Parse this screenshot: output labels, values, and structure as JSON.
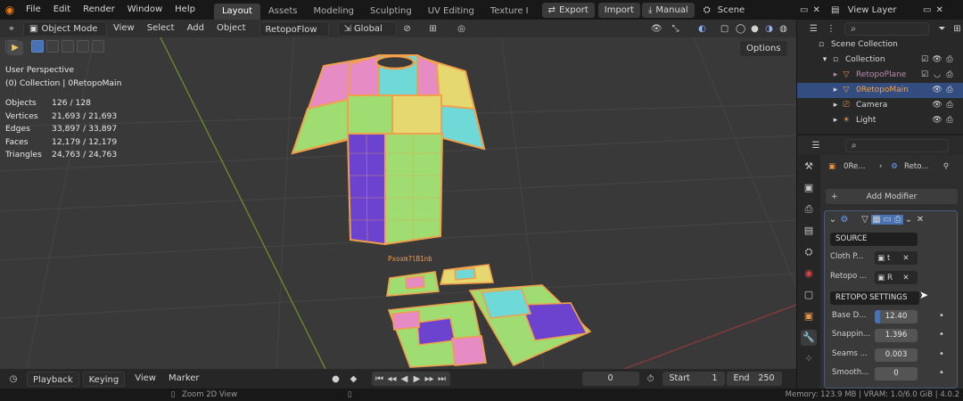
{
  "topbar": {
    "menus": [
      "File",
      "Edit",
      "Render",
      "Window",
      "Help"
    ],
    "workspaces": [
      "Layout",
      "Assets",
      "Modeling",
      "Sculpting",
      "UV Editing",
      "Texture I"
    ],
    "active_workspace": "Layout",
    "export_label": "Export",
    "import_label": "Import",
    "manual_label": "Manual",
    "scene_value": "Scene",
    "view_layer_value": "View Layer"
  },
  "viewport_header": {
    "mode": "Object Mode",
    "menus": [
      "View",
      "Select",
      "Add",
      "Object"
    ],
    "addon_menu": "RetopoFlow",
    "transform_orientation": "Global",
    "options_label": "Options"
  },
  "overlay": {
    "view_name": "User Perspective",
    "collection_line": "(0) Collection | 0RetopoMain",
    "stats": [
      {
        "label": "Objects",
        "value": "126 / 128"
      },
      {
        "label": "Vertices",
        "value": "21,693 / 21,693"
      },
      {
        "label": "Edges",
        "value": "33,897 / 33,897"
      },
      {
        "label": "Faces",
        "value": "12,179 / 12,179"
      },
      {
        "label": "Triangles",
        "value": "24,763 / 24,763"
      }
    ],
    "floor_text": "Pxoxm7lB1nb"
  },
  "timeline": {
    "playback": "Playback",
    "keying": "Keying",
    "view": "View",
    "marker": "Marker",
    "current_frame": "0",
    "start_label": "Start",
    "start_value": "1",
    "end_label": "End",
    "end_value": "250"
  },
  "statusbar": {
    "hint": "Zoom 2D View",
    "stats": "Memory: 123.9 MB | VRAM: 1.0/6.0 GiB | 4.0.2"
  },
  "outliner": {
    "search_placeholder": "",
    "items": [
      {
        "label": "Scene Collection",
        "indent": 0
      },
      {
        "label": "Collection",
        "indent": 1
      },
      {
        "label": "RetopoPlane",
        "indent": 2
      },
      {
        "label": "0RetopoMain",
        "indent": 2,
        "selected": true
      },
      {
        "label": "Camera",
        "indent": 2
      },
      {
        "label": "Light",
        "indent": 2
      }
    ]
  },
  "properties": {
    "breadcrumb_object": "0Re...",
    "breadcrumb_modifier": "Reto...",
    "add_modifier_label": "Add Modifier",
    "source_section": "SOURCE",
    "cloth_label": "Cloth P...",
    "cloth_value": "t",
    "retopo_label": "Retopo ...",
    "retopo_value": "R",
    "settings_section": "RETOPO SETTINGS",
    "params": [
      {
        "label": "Base D...",
        "value": "12.40",
        "fill": 0.12
      },
      {
        "label": "Snappin...",
        "value": "1.396"
      },
      {
        "label": "Seams ...",
        "value": "0.003"
      },
      {
        "label": "Smooth...",
        "value": "0"
      }
    ]
  },
  "colors": {
    "selection": "#4772b3",
    "mesh_orange": "#f0a04a",
    "pink": "#e68bc4",
    "cyan": "#6fd9d8",
    "green": "#9fdc72",
    "purple": "#6b43cf",
    "yellow": "#e6d870"
  }
}
